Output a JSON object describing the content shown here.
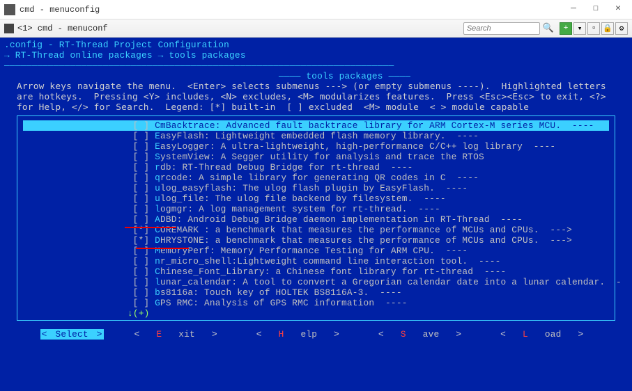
{
  "window": {
    "title": "cmd - menuconfig"
  },
  "toolbar": {
    "tab_label": "<1> cmd - menuconf",
    "search_placeholder": "Search"
  },
  "config": {
    "title": ".config - RT-Thread Project Configuration",
    "path_prefix": "→ RT-Thread online packages → tools packages ",
    "group": "tools packages",
    "help": "Arrow keys navigate the menu.  <Enter> selects submenus ---> (or empty submenus ----).  Highlighted letters\nare hotkeys.  Pressing <Y> includes, <N> excludes, <M> modularizes features.  Press <Esc><Esc> to exit, <?>\nfor Help, </> for Search.  Legend: [*] built-in  [ ] excluded  <M> module  < > module capable",
    "more": "↓(+)"
  },
  "items": [
    {
      "mark": "[ ]",
      "hot": "C",
      "rest": "mBacktrace: Advanced fault backtrace library for ARM Cortex-M series MCU.  ----",
      "pad": "",
      "selected": true
    },
    {
      "mark": "[ ]",
      "hot": "E",
      "rest": "asyFlash: Lightweight embedded flash memory library.  ----",
      "pad": ""
    },
    {
      "mark": "[ ]",
      "hot": "E",
      "rest": "asyLogger: A ultra-lightweight, high-performance C/C++ log library  ----",
      "pad": ""
    },
    {
      "mark": "[ ]",
      "hot": "S",
      "rest": "ystemView: A Segger utility for analysis and trace the RTOS",
      "pad": ""
    },
    {
      "mark": "[ ]",
      "hot": "r",
      "rest": "db: RT-Thread Debug Bridge for rt-thread  ----",
      "pad": ""
    },
    {
      "mark": "[ ]",
      "hot": "q",
      "rest": "rcode: A simple library for generating QR codes in C  ----",
      "pad": ""
    },
    {
      "mark": "[ ]",
      "hot": "u",
      "rest": "log_easyflash: The ulog flash plugin by EasyFlash.  ----",
      "pad": ""
    },
    {
      "mark": "[ ]",
      "hot": "u",
      "rest": "log_file: The ulog file backend by filesystem.  ----",
      "pad": ""
    },
    {
      "mark": "[ ]",
      "hot": "l",
      "rest": "ogmgr: A log management system for rt-thread.  ----",
      "pad": ""
    },
    {
      "mark": "[ ]",
      "hot": "A",
      "rest": "DBD: Android Debug Bridge daemon implementation in RT-Thread  ----",
      "pad": ""
    },
    {
      "mark": "[*]",
      "hot": "C",
      "rest": "OREMARK : a benchmark that measures the performance of MCUs and CPUs.  --->",
      "pad": ""
    },
    {
      "mark": "[*]",
      "hot": "D",
      "rest": "HRYSTONE: a benchmark that measures the performance of MCUs and CPUs.  --->",
      "pad": ""
    },
    {
      "mark": "[ ]",
      "hot": "M",
      "rest": "emoryPerf: Memory Performance Testing for ARM CPU.  ----",
      "pad": ""
    },
    {
      "mark": "[ ]",
      "hot": "n",
      "rest": "r_micro_shell:Lightweight command line interaction tool.  ----",
      "pad": ""
    },
    {
      "mark": "[ ]",
      "hot": "C",
      "rest": "hinese_Font_Library: a Chinese font library for rt-thread  ----",
      "pad": ""
    },
    {
      "mark": "[ ]",
      "hot": "l",
      "rest": "unar_calendar: A tool to convert a Gregorian calendar date into a lunar calendar.  -",
      "pad": ""
    },
    {
      "mark": "[ ]",
      "hot": "b",
      "rest": "s8116a: Touch key of HOLTEK BS8116A-3.  ----",
      "pad": ""
    },
    {
      "mark": "[ ]",
      "hot": "G",
      "rest": "PS RMC: Analysis of GPS RMC information  ----",
      "pad": ""
    }
  ],
  "actions": {
    "select": "Select",
    "exit_pre": "E",
    "exit_rest": "xit",
    "help_pre": "H",
    "help_rest": "elp",
    "save_pre": "S",
    "save_rest": "ave",
    "load_pre": "L",
    "load_rest": "oad"
  }
}
